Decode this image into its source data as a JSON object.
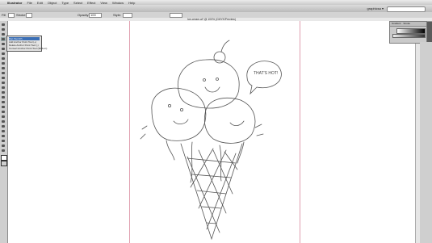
{
  "menubar": {
    "apple": "",
    "items": [
      "Illustrator",
      "File",
      "Edit",
      "Object",
      "Type",
      "Select",
      "Effect",
      "View",
      "Window",
      "Help"
    ],
    "clock": ""
  },
  "appbar": {
    "workspace": "graphicsa ▾"
  },
  "controlbar": {
    "labels": [
      "Fill",
      "Stroke",
      "Opacity:",
      "100",
      "Style:"
    ]
  },
  "document": {
    "tab_title": "Ice-cream.ai* @ 100% (CMYK/Preview)"
  },
  "flyout": {
    "items": [
      "Pen Tool (P)",
      "Add Anchor Point Tool (+)",
      "Delete Anchor Point Tool (-)",
      "Convert Anchor Point Tool (Shift+C)"
    ]
  },
  "panel": {
    "tabs": [
      "Gradient",
      "Stroke"
    ]
  },
  "drawing": {
    "speech_bubble": "THAT'S HOT!"
  }
}
